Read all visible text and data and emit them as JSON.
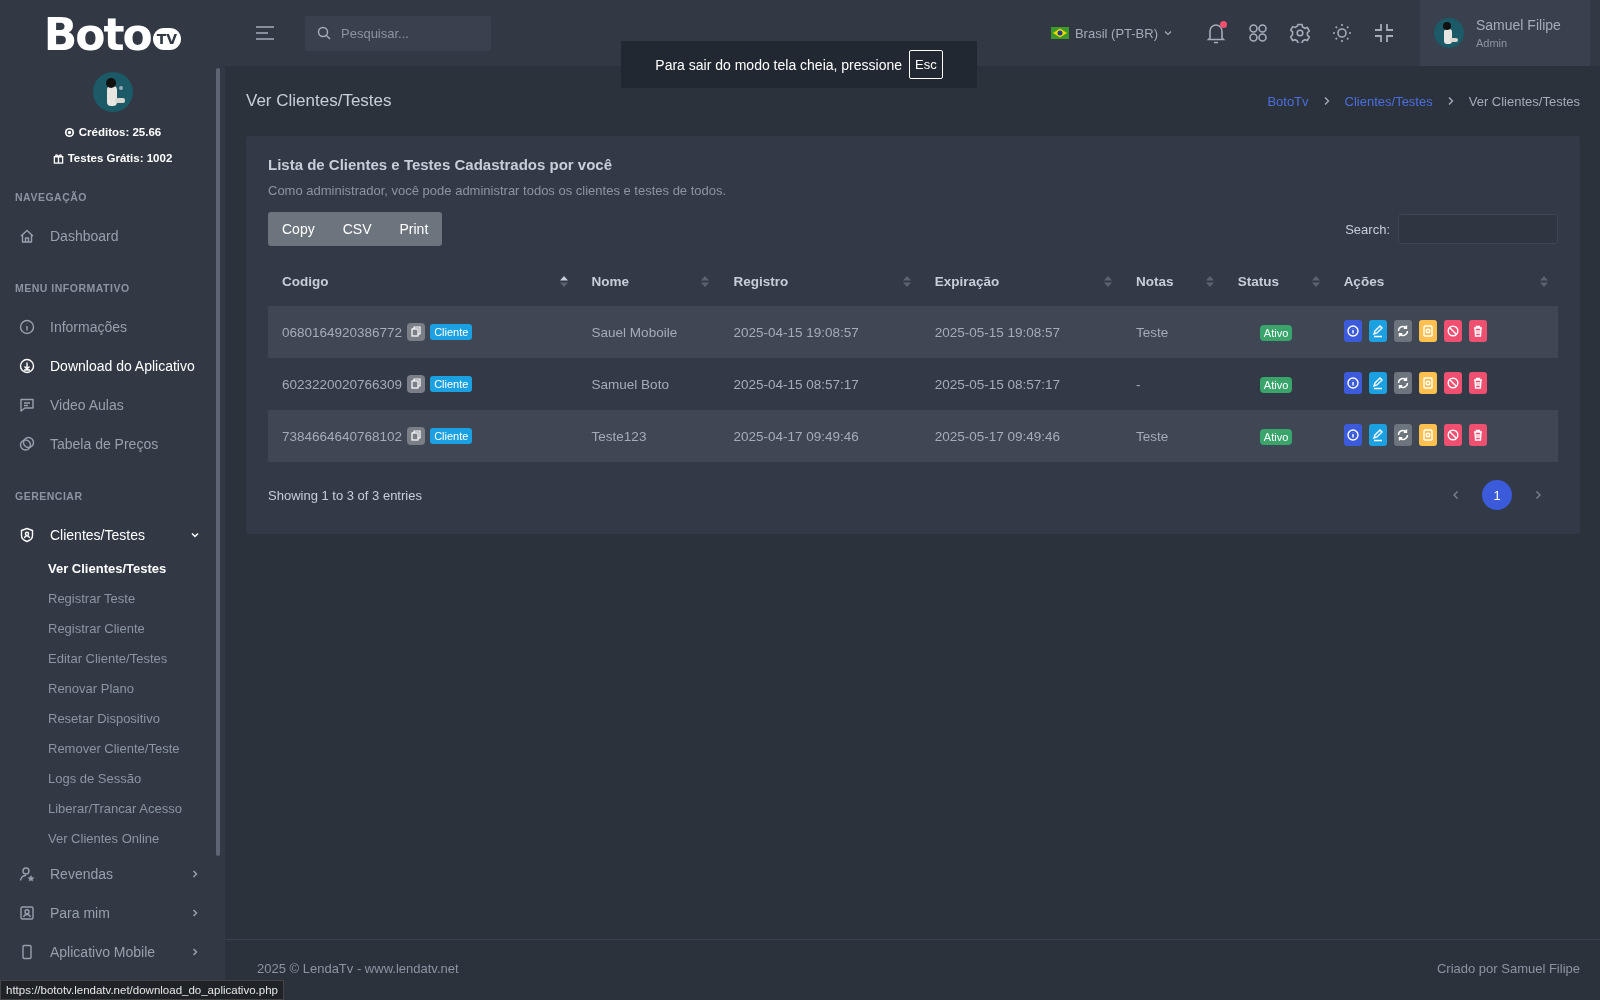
{
  "logo": {
    "text": "Boto",
    "badge": "TV"
  },
  "sidebar": {
    "credits": "Créditos: 25.66",
    "free_tests": "Testes Grátis: 1002",
    "sections": [
      {
        "title": "NAVEGAÇÃO",
        "items": [
          {
            "label": "Dashboard",
            "hovered": false,
            "expanded": false
          }
        ]
      },
      {
        "title": "MENU INFORMATIVO",
        "items": [
          {
            "label": "Informações",
            "hovered": false,
            "expanded": false
          },
          {
            "label": "Download do Aplicativo",
            "hovered": true,
            "expanded": false
          },
          {
            "label": "Video Aulas",
            "hovered": false,
            "expanded": false
          },
          {
            "label": "Tabela de Preços",
            "hovered": false,
            "expanded": false
          }
        ]
      },
      {
        "title": "GERENCIAR",
        "items": [
          {
            "label": "Clientes/Testes",
            "hovered": false,
            "expanded": true,
            "children": [
              {
                "label": "Ver Clientes/Testes",
                "selected": true
              },
              {
                "label": "Registrar Teste",
                "selected": false
              },
              {
                "label": "Registrar Cliente",
                "selected": false
              },
              {
                "label": "Editar Cliente/Testes",
                "selected": false
              },
              {
                "label": "Renovar Plano",
                "selected": false
              },
              {
                "label": "Resetar Dispositivo",
                "selected": false
              },
              {
                "label": "Remover Cliente/Teste",
                "selected": false
              },
              {
                "label": "Logs de Sessão",
                "selected": false
              },
              {
                "label": "Liberar/Trancar Acesso",
                "selected": false
              },
              {
                "label": "Ver Clientes Online",
                "selected": false
              }
            ]
          },
          {
            "label": "Revendas",
            "hovered": false,
            "expanded": false
          },
          {
            "label": "Para mim",
            "hovered": false,
            "expanded": false
          },
          {
            "label": "Aplicativo Mobile",
            "hovered": false,
            "expanded": false
          }
        ]
      }
    ]
  },
  "topbar": {
    "search": {
      "placeholder": "Pesquisar..."
    },
    "language": "Brasil (PT-BR)",
    "notifications_unread": true,
    "user": {
      "name": "Samuel Filipe",
      "role": "Admin"
    }
  },
  "fullscreen_notice": {
    "text": "Para sair do modo tela cheia, pressione",
    "key": "Esc"
  },
  "page_title": "Ver Clientes/Testes",
  "breadcrumb": [
    {
      "label": "BotoTv",
      "link": true
    },
    {
      "label": "Clientes/Testes",
      "link": true
    },
    {
      "label": "Ver Clientes/Testes",
      "link": false
    }
  ],
  "card": {
    "title": "Lista de Clientes e Testes Cadastrados por você",
    "subtitle": "Como administrador, você pode administrar todos os clientes e testes de todos.",
    "export_buttons": [
      "Copy",
      "CSV",
      "Print"
    ],
    "search_label": "Search:",
    "table": {
      "columns": [
        {
          "label": "Codigo",
          "sorted": true
        },
        {
          "label": "Nome",
          "sorted": false
        },
        {
          "label": "Registro",
          "sorted": false
        },
        {
          "label": "Expiração",
          "sorted": false
        },
        {
          "label": "Notas",
          "sorted": false
        },
        {
          "label": "Status",
          "sorted": false
        },
        {
          "label": "Ações",
          "sorted": false
        }
      ],
      "rows": [
        {
          "code": "0680164920386772",
          "type": "Cliente",
          "name": "Sauel Moboile",
          "registered": "2025-04-15 19:08:57",
          "expires": "2025-05-15 19:08:57",
          "notes": "Teste",
          "status": "Ativo"
        },
        {
          "code": "6023220020766309",
          "type": "Cliente",
          "name": "Samuel Boto",
          "registered": "2025-04-15 08:57:17",
          "expires": "2025-05-15 08:57:17",
          "notes": "-",
          "status": "Ativo"
        },
        {
          "code": "7384664640768102",
          "type": "Cliente",
          "name": "Teste123",
          "registered": "2025-04-17 09:49:46",
          "expires": "2025-05-17 09:49:46",
          "notes": "Teste",
          "status": "Ativo"
        }
      ]
    },
    "info": "Showing 1 to 3 of 3 entries",
    "pages": [
      {
        "label": "1",
        "selected": true
      }
    ]
  },
  "footer": {
    "left": "2025 © LendaTv - www.lendatv.net",
    "right": "Criado por Samuel Filipe"
  },
  "status_url": "https://bototv.lendatv.net/download_do_aplicativo.php"
}
